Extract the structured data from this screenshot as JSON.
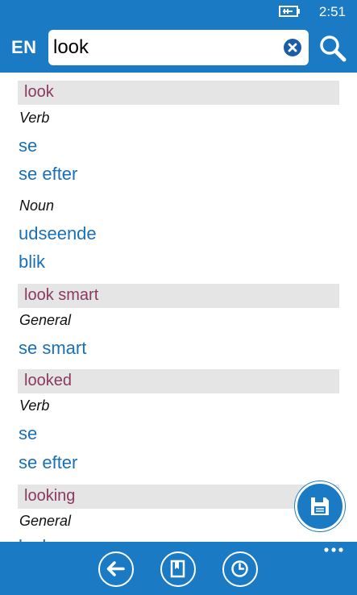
{
  "status_bar": {
    "time": "2:51"
  },
  "header": {
    "language": "EN",
    "search_value": "look"
  },
  "results": [
    {
      "term": "look",
      "groups": [
        {
          "pos": "Verb",
          "translations": [
            "se",
            "se efter"
          ]
        },
        {
          "pos": "Noun",
          "translations": [
            "udseende",
            "blik"
          ]
        }
      ]
    },
    {
      "term": "look smart",
      "groups": [
        {
          "pos": "General",
          "translations": [
            "se smart"
          ]
        }
      ]
    },
    {
      "term": "looked",
      "groups": [
        {
          "pos": "Verb",
          "translations": [
            "se",
            "se efter"
          ]
        }
      ]
    },
    {
      "term": "looking",
      "groups": [
        {
          "pos": "General",
          "translations": [
            "look"
          ]
        }
      ]
    }
  ],
  "icons": {
    "battery": "battery-charging-icon",
    "clear": "clear-icon",
    "search": "search-icon",
    "save": "save-icon",
    "back": "back-arrow-icon",
    "flashcards": "book-icon",
    "history": "clock-icon",
    "more": "more-icon"
  },
  "colors": {
    "accent": "#1a7bc4",
    "term": "#8a3a60",
    "translation": "#1a70b8",
    "term_background": "#e5e5e5"
  }
}
